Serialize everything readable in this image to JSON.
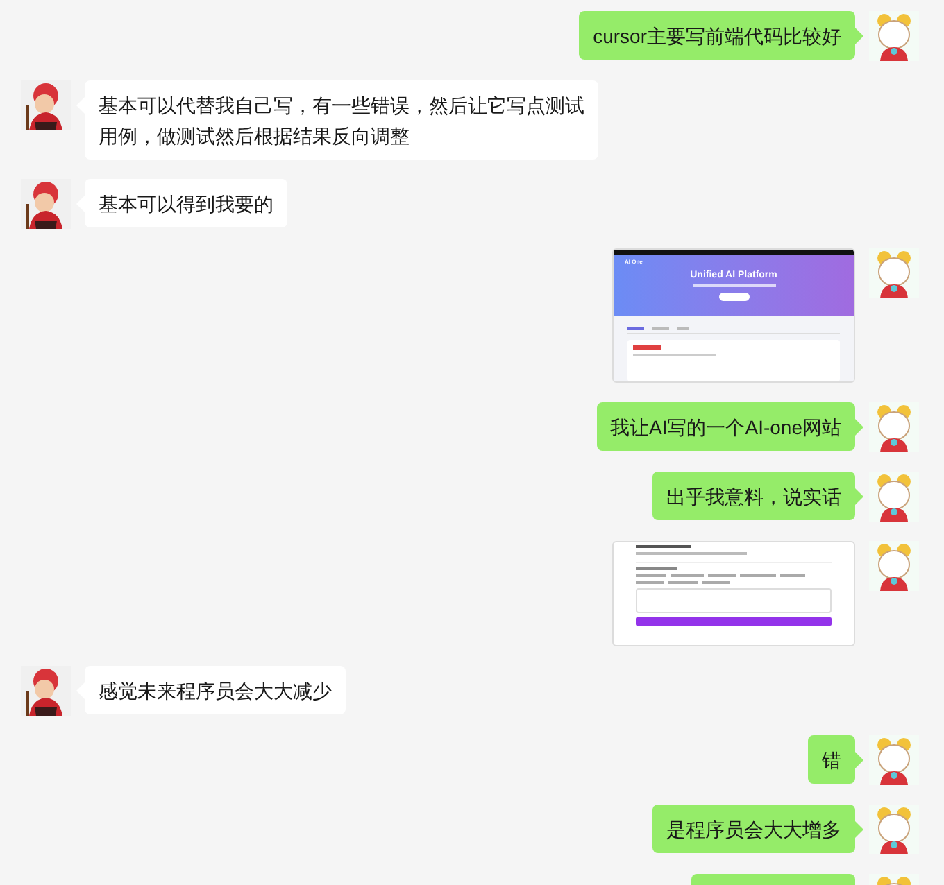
{
  "messages": [
    {
      "outgoing": true,
      "kind": "text",
      "text": "cursor主要写前端代码比较好"
    },
    {
      "outgoing": false,
      "kind": "text",
      "text": "基本可以代替我自己写，有一些错误，然后让它写点测试用例，做测试然后根据结果反向调整"
    },
    {
      "outgoing": false,
      "kind": "text",
      "text": "基本可以得到我要的"
    },
    {
      "outgoing": true,
      "kind": "site_screenshot",
      "brand": "AI One",
      "headline": "Unified AI Platform"
    },
    {
      "outgoing": true,
      "kind": "text",
      "text": "我让AI写的一个AI-one网站"
    },
    {
      "outgoing": true,
      "kind": "text",
      "text": "出乎我意料，说实话"
    },
    {
      "outgoing": true,
      "kind": "form_screenshot"
    },
    {
      "outgoing": false,
      "kind": "text",
      "text": "感觉未来程序员会大大减少"
    },
    {
      "outgoing": true,
      "kind": "text",
      "text": "错"
    },
    {
      "outgoing": true,
      "kind": "text",
      "text": "是程序员会大大增多"
    },
    {
      "outgoing": true,
      "kind": "clipped"
    }
  ]
}
